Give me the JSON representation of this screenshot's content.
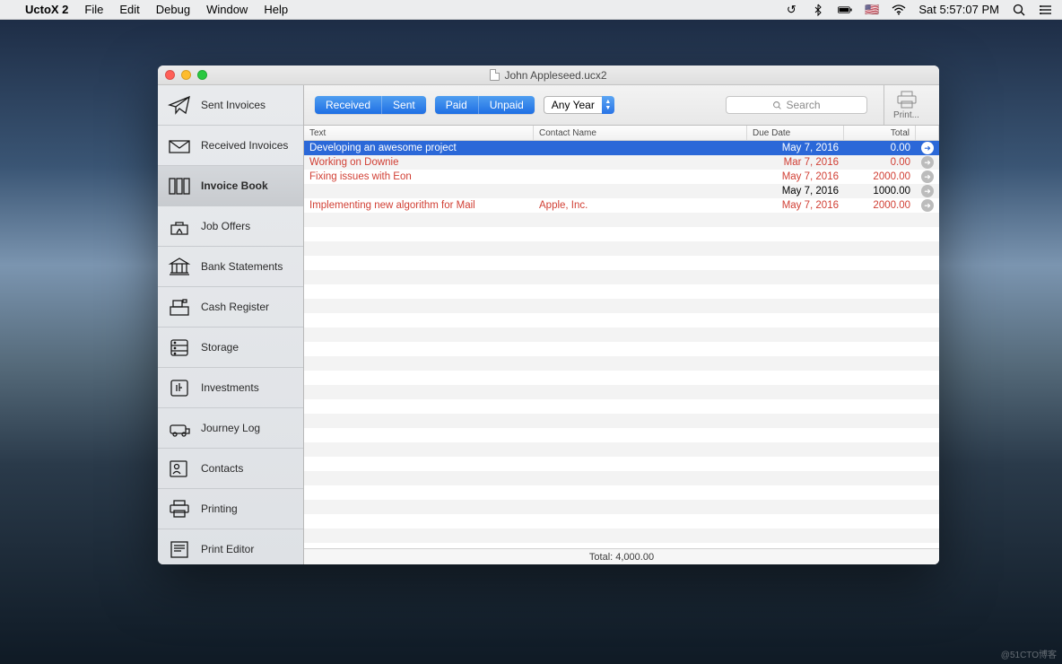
{
  "menubar": {
    "app": "UctoX 2",
    "items": [
      "File",
      "Edit",
      "Debug",
      "Window",
      "Help"
    ],
    "clock": "Sat 5:57:07 PM"
  },
  "window": {
    "title": "John Appleseed.ucx2"
  },
  "sidebar": {
    "items": [
      {
        "id": "sent-invoices",
        "label": "Sent Invoices"
      },
      {
        "id": "received-invoices",
        "label": "Received Invoices"
      },
      {
        "id": "invoice-book",
        "label": "Invoice Book",
        "selected": true
      },
      {
        "id": "job-offers",
        "label": "Job Offers"
      },
      {
        "id": "bank-statements",
        "label": "Bank Statements"
      },
      {
        "id": "cash-register",
        "label": "Cash Register"
      },
      {
        "id": "storage",
        "label": "Storage"
      },
      {
        "id": "investments",
        "label": "Investments"
      },
      {
        "id": "journey-log",
        "label": "Journey Log"
      },
      {
        "id": "contacts",
        "label": "Contacts"
      },
      {
        "id": "printing",
        "label": "Printing"
      },
      {
        "id": "print-editor",
        "label": "Print Editor"
      }
    ]
  },
  "toolbar": {
    "seg1": [
      "Received",
      "Sent"
    ],
    "seg2": [
      "Paid",
      "Unpaid"
    ],
    "year": "Any Year",
    "search_placeholder": "Search",
    "print_label": "Print..."
  },
  "columns": {
    "text": "Text",
    "contact": "Contact Name",
    "due": "Due Date",
    "total": "Total"
  },
  "rows": [
    {
      "text": "Developing an awesome project",
      "contact": "",
      "due": "May 7, 2016",
      "total": "0.00",
      "selected": true,
      "red": false
    },
    {
      "text": "Working on Downie",
      "contact": "",
      "due": "Mar 7, 2016",
      "total": "0.00",
      "selected": false,
      "red": true
    },
    {
      "text": "Fixing issues with Eon",
      "contact": "",
      "due": "May 7, 2016",
      "total": "2000.00",
      "selected": false,
      "red": true
    },
    {
      "text": "",
      "contact": "",
      "due": "May 7, 2016",
      "total": "1000.00",
      "selected": false,
      "red": false
    },
    {
      "text": "Implementing new algorithm for Mail",
      "contact": "Apple, Inc.",
      "due": "May 7, 2016",
      "total": "2000.00",
      "selected": false,
      "red": true
    }
  ],
  "footer": {
    "total_label": "Total: 4,000.00"
  },
  "watermark": "@51CTO博客"
}
